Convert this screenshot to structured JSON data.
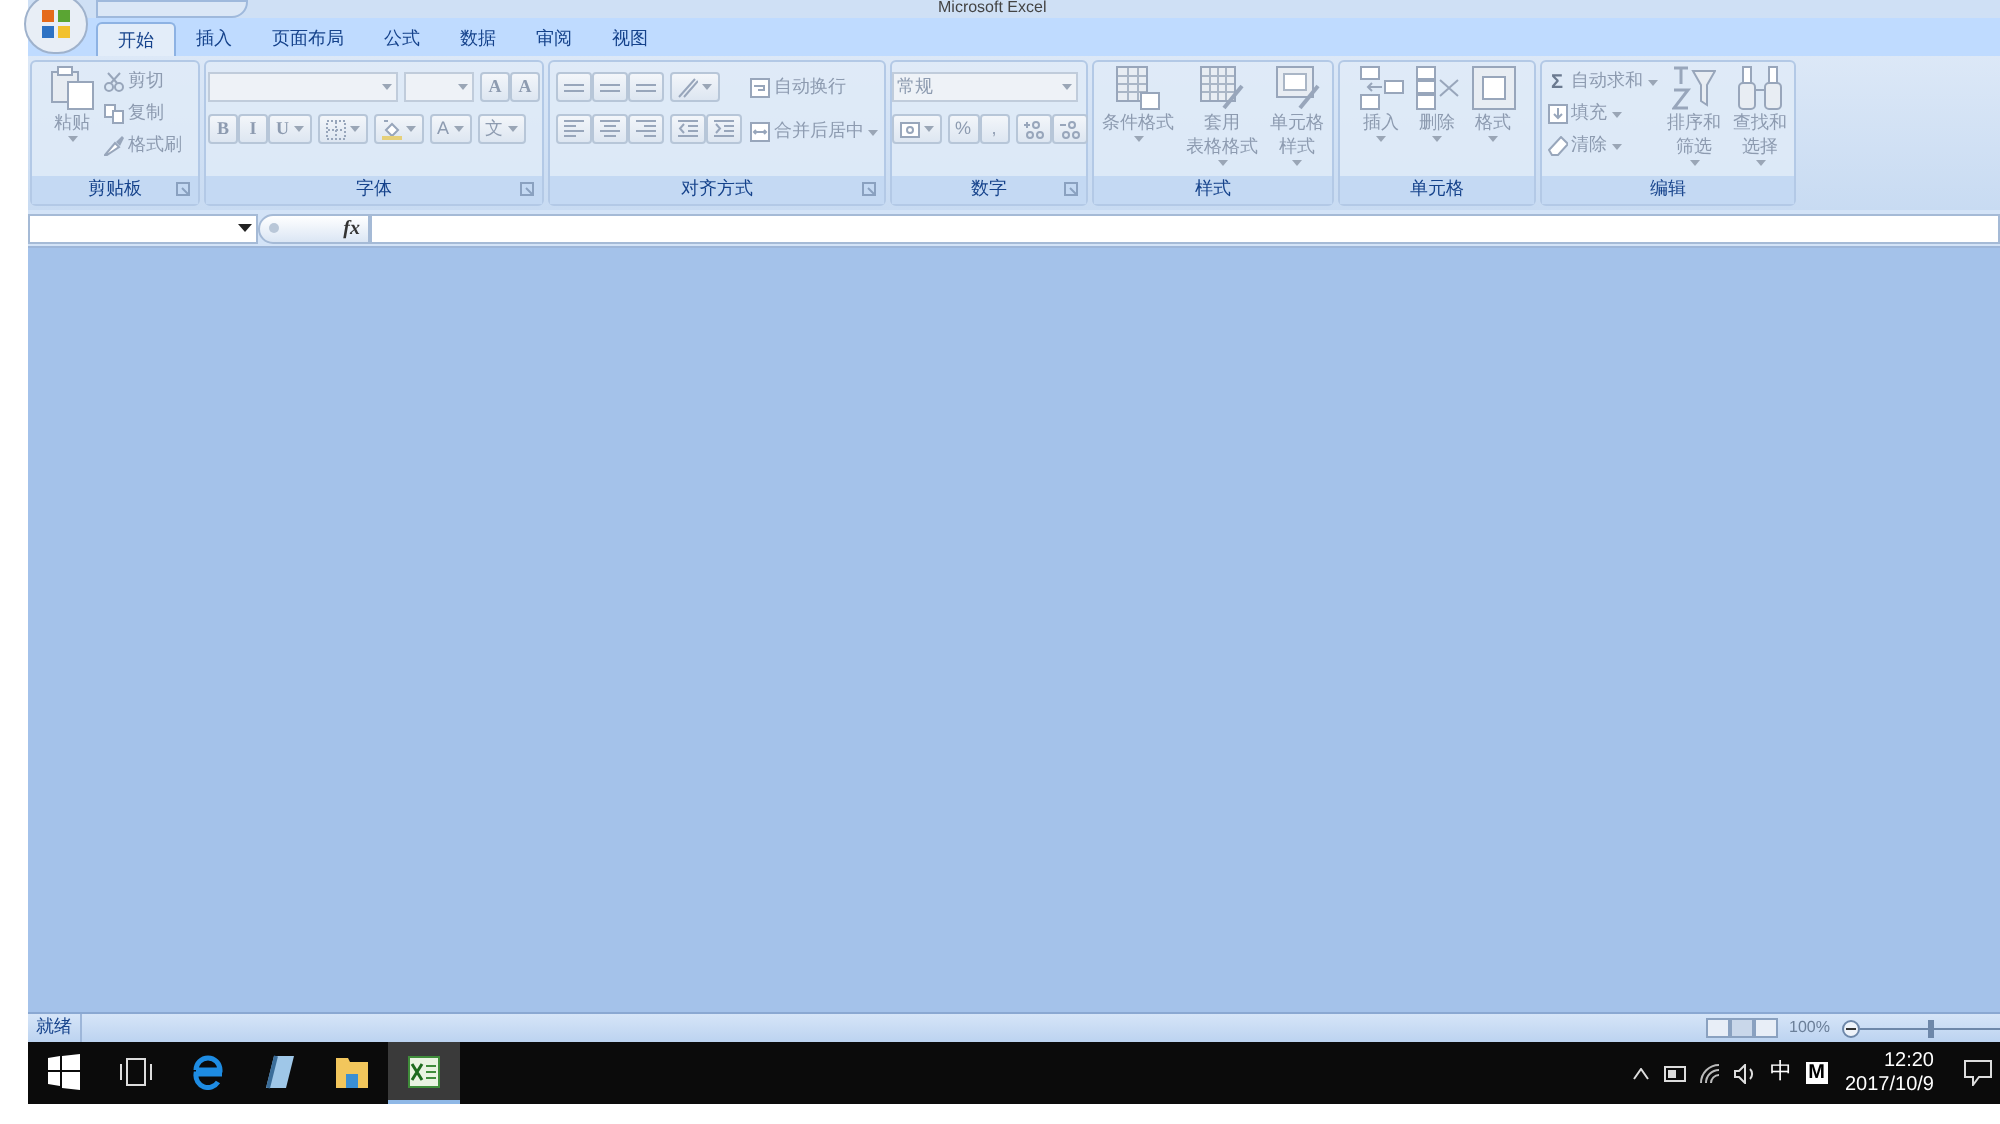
{
  "window": {
    "title": "Microsoft Excel"
  },
  "tabs": [
    {
      "label": "开始",
      "selected": true
    },
    {
      "label": "插入",
      "selected": false
    },
    {
      "label": "页面布局",
      "selected": false
    },
    {
      "label": "公式",
      "selected": false
    },
    {
      "label": "数据",
      "selected": false
    },
    {
      "label": "审阅",
      "selected": false
    },
    {
      "label": "视图",
      "selected": false
    }
  ],
  "ribbon_groups": [
    {
      "label": "剪贴板",
      "buttons": [
        [
          "粘贴"
        ],
        "剪切",
        "复制",
        "格式刷"
      ]
    },
    {
      "label": "字体",
      "buttons": [
        "A",
        "A",
        "B",
        "I",
        "U",
        "A",
        "文"
      ]
    },
    {
      "label": "对齐方式",
      "buttons": [
        "自动换行",
        "合并后居中"
      ]
    },
    {
      "label": "数字",
      "number_format": "常规",
      "buttons": [
        "%",
        ","
      ]
    },
    {
      "label": "样式",
      "buttons": [
        [
          "条件格式"
        ],
        [
          "套用",
          "表格格式"
        ],
        [
          "单元格",
          "样式"
        ]
      ]
    },
    {
      "label": "单元格",
      "buttons": [
        [
          "插入"
        ],
        [
          "删除"
        ],
        [
          "格式"
        ]
      ]
    },
    {
      "label": "编辑",
      "sum_symbol": "Σ",
      "buttons": [
        "自动求和",
        "填充",
        "清除",
        [
          "排序和",
          "筛选"
        ],
        [
          "查找和",
          "选择"
        ]
      ]
    }
  ],
  "formula_bar": {
    "fx": "fx"
  },
  "status_bar": {
    "status": "就绪",
    "zoom": "100%",
    "zoom_slider": {
      "level": 0.5
    }
  },
  "taskbar": {
    "apps": [
      {
        "selected": false
      },
      {
        "selected": false
      },
      {
        "selected": false
      },
      {
        "selected": false
      },
      {
        "selected": false
      },
      {
        "selected": true
      }
    ],
    "tray": {
      "ime": "中",
      "ime_mode": "M",
      "time": "12:20",
      "date": "2017/10/9"
    }
  }
}
